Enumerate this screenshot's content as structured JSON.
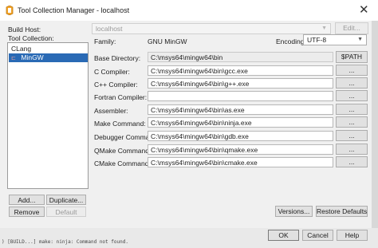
{
  "window": {
    "title": "Tool Collection Manager - localhost",
    "close_glyph": "✕"
  },
  "build_host": {
    "label": "Build Host:",
    "value": "localhost",
    "edit_label": "Edit..."
  },
  "tool_collection": {
    "label": "Tool Collection:",
    "items": [
      {
        "label": "CLang",
        "selected": false
      },
      {
        "label": "MinGW",
        "selected": true,
        "icon": "flag-icon",
        "icon_glyph": "⊏"
      }
    ],
    "add_label": "Add...",
    "duplicate_label": "Duplicate...",
    "remove_label": "Remove",
    "default_label": "Default"
  },
  "details": {
    "family_label": "Family:",
    "family_value": "GNU MinGW",
    "encoding_label": "Encoding:",
    "encoding_value": "UTF-8",
    "base_dir_label": "Base Directory:",
    "base_dir_value": "C:\\msys64\\mingw64\\bin",
    "path_button": "$PATH",
    "tools": [
      {
        "label": "C Compiler:",
        "value": "C:\\msys64\\mingw64\\bin\\gcc.exe",
        "browse": "..."
      },
      {
        "label": "C++ Compiler:",
        "value": "C:\\msys64\\mingw64\\bin\\g++.exe",
        "browse": "..."
      },
      {
        "label": "Fortran Compiler:",
        "value": "",
        "browse": "..."
      },
      {
        "label": "Assembler:",
        "value": "C:\\msys64\\mingw64\\bin\\as.exe",
        "browse": "..."
      },
      {
        "label": "Make Command:",
        "value": "C:\\msys64\\mingw64\\bin\\ninja.exe",
        "browse": "..."
      },
      {
        "label": "Debugger Command:",
        "value": "C:\\msys64\\mingw64\\bin\\gdb.exe",
        "browse": "..."
      },
      {
        "label": "QMake Command:",
        "value": "C:\\msys64\\mingw64\\bin\\qmake.exe",
        "browse": "..."
      },
      {
        "label": "CMake Command:",
        "value": "C:\\msys64\\mingw64\\bin\\cmake.exe",
        "browse": "..."
      }
    ],
    "versions_label": "Versions...",
    "restore_label": "Restore Defaults"
  },
  "footer": {
    "ok_label": "OK",
    "cancel_label": "Cancel",
    "help_label": "Help"
  },
  "background_text": "  ) [BUILD...] make: ninja: Command not found."
}
